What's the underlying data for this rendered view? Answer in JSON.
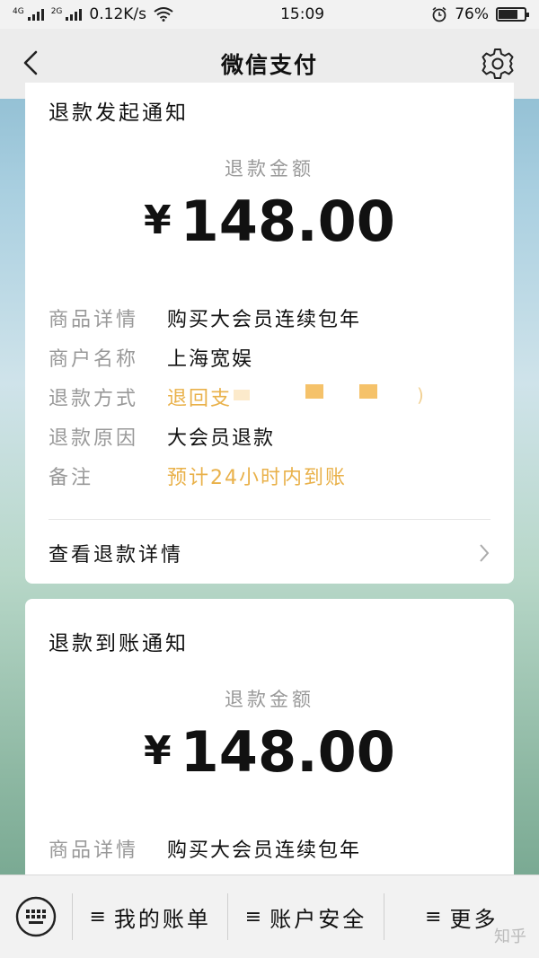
{
  "status_bar": {
    "network_label": "4G",
    "network2_label": "2G",
    "speed": "0.12K/s",
    "time": "15:09",
    "battery": "76%",
    "battery_level": 0.76
  },
  "nav": {
    "title": "微信支付"
  },
  "card1": {
    "title": "退款发起通知",
    "amount_label": "退款金额",
    "currency": "¥",
    "amount": "148.00",
    "rows": [
      {
        "key": "商品详情",
        "value": "购买大会员连续包年"
      },
      {
        "key": "商户名称",
        "value": "上海宽娱"
      },
      {
        "key": "退款方式",
        "value": "退回支",
        "value_suffix": ")"
      },
      {
        "key": "退款原因",
        "value": "大会员退款"
      },
      {
        "key": "备注",
        "value": "预计24小时内到账"
      }
    ],
    "detail_link": "查看退款详情"
  },
  "card2": {
    "title": "退款到账通知",
    "amount_label": "退款金额",
    "currency": "¥",
    "amount": "148.00",
    "rows": [
      {
        "key": "商品详情",
        "value": "购买大会员连续包年"
      }
    ]
  },
  "bottom_menu": {
    "items": [
      {
        "label": "我的账单"
      },
      {
        "label": "账户安全"
      },
      {
        "label": "更多"
      }
    ],
    "hamburger_glyph": "≡"
  },
  "watermark": "知乎",
  "colors": {
    "accent_orange": "#e9b14a",
    "muted_gray": "#999999"
  },
  "icons": [
    "back-arrow-icon",
    "gear-icon",
    "keyboard-icon",
    "wifi-icon",
    "alarm-icon",
    "battery-icon",
    "chevron-right-icon"
  ]
}
